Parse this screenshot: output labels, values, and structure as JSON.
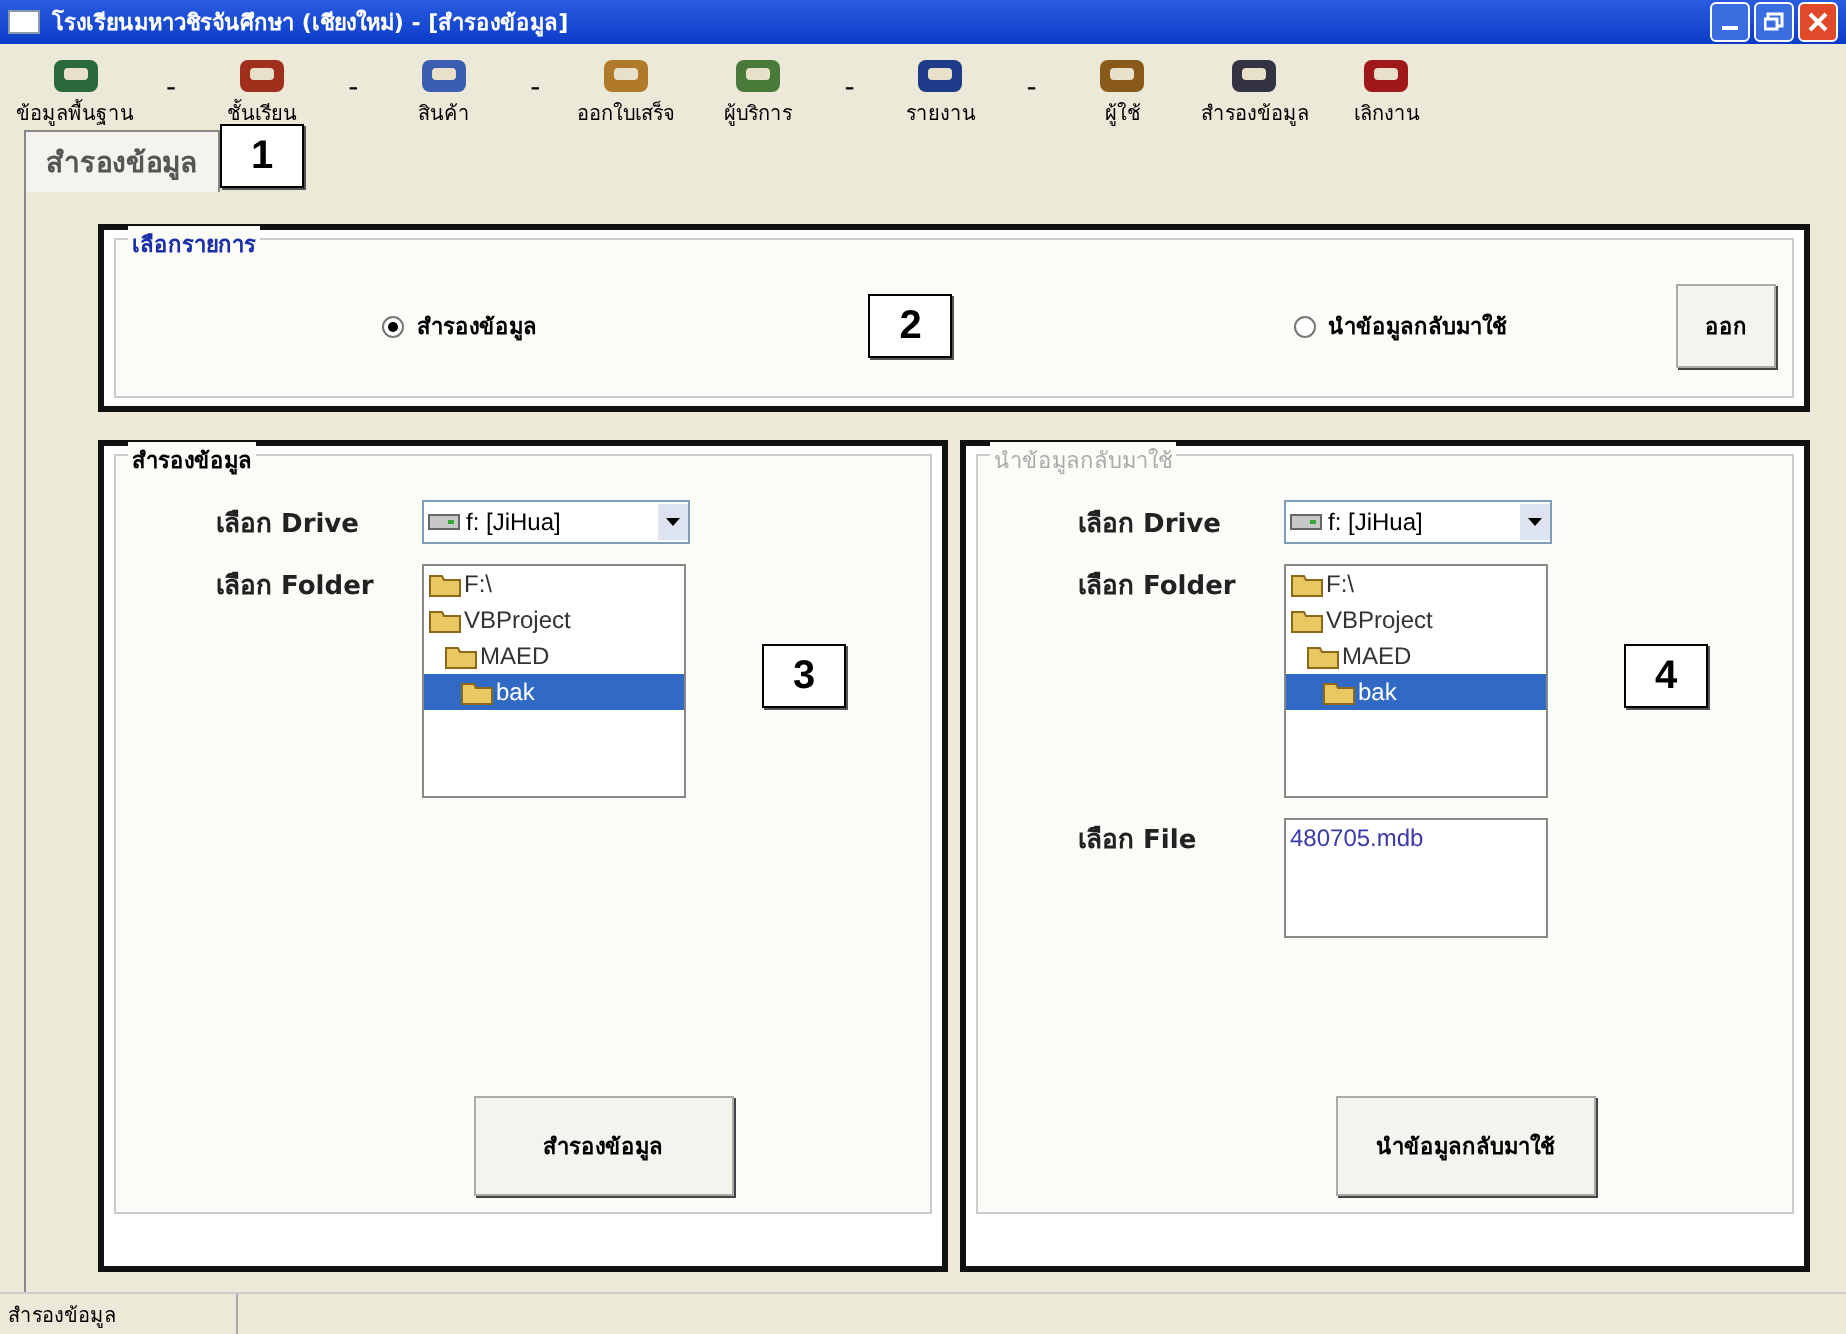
{
  "window": {
    "title": "โรงเรียนมหาวชิรจันศึกษา (เชียงใหม่) - [สำรองข้อมูล]"
  },
  "toolbar": [
    {
      "kind": "button",
      "label": "ข้อมูลพื้นฐาน"
    },
    {
      "kind": "separator",
      "label": "-"
    },
    {
      "kind": "button",
      "label": "ชั้นเรียน"
    },
    {
      "kind": "separator",
      "label": "-"
    },
    {
      "kind": "button",
      "label": "สินค้า"
    },
    {
      "kind": "separator",
      "label": "-"
    },
    {
      "kind": "button",
      "label": "ออกใบเสร็จ"
    },
    {
      "kind": "button",
      "label": "ผู้บริการ"
    },
    {
      "kind": "separator",
      "label": "-"
    },
    {
      "kind": "button",
      "label": "รายงาน"
    },
    {
      "kind": "separator",
      "label": "-"
    },
    {
      "kind": "button",
      "label": "ผู้ใช้"
    },
    {
      "kind": "button",
      "label": "สำรองข้อมูล"
    },
    {
      "kind": "button",
      "label": "เลิกงาน"
    }
  ],
  "tabs": [
    {
      "label": "สำรองข้อมูล",
      "selected": true,
      "callout": "1"
    }
  ],
  "options": {
    "title": "เลือกรายการ",
    "callout": "2",
    "radios": [
      {
        "label": "สำรองข้อมูล",
        "selected": true
      },
      {
        "label": "นำข้อมูลกลับมาใช้",
        "selected": false
      }
    ],
    "exit_button": "ออก"
  },
  "backup": {
    "title": "สำรองข้อมูล",
    "disabled": false,
    "callout": "3",
    "drive_label": "เลือก Drive",
    "drive": "f: [JiHua]",
    "folder_label": "เลือก Folder",
    "folders": [
      {
        "name": "F:\\",
        "selected": false,
        "children": [
          {
            "name": "VBProject",
            "selected": false,
            "children": [
              {
                "name": "MAED",
                "selected": false,
                "children": [
                  {
                    "name": "bak",
                    "selected": true
                  }
                ]
              }
            ]
          }
        ]
      }
    ],
    "button": "สำรองข้อมูล"
  },
  "restore": {
    "title": "นำข้อมูลกลับมาใช้",
    "disabled": true,
    "callout": "4",
    "drive_label": "เลือก Drive",
    "drive": "f: [JiHua]",
    "folder_label": "เลือก Folder",
    "folders": [
      {
        "name": "F:\\",
        "selected": false,
        "children": [
          {
            "name": "VBProject",
            "selected": false,
            "children": [
              {
                "name": "MAED",
                "selected": false,
                "children": [
                  {
                    "name": "bak",
                    "selected": true
                  }
                ]
              }
            ]
          }
        ]
      }
    ],
    "file_label": "เลือก File",
    "files": [
      "480705.mdb"
    ],
    "button": "นำข้อมูลกลับมาใช้"
  },
  "status_bar": "สำรองข้อมูล"
}
